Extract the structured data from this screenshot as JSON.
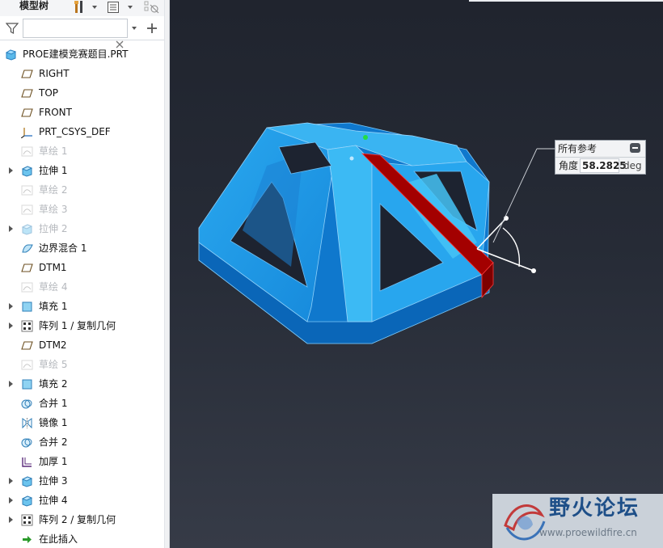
{
  "tree_panel": {
    "title": "模型树",
    "filter": {
      "value": "",
      "placeholder": ""
    },
    "items": [
      {
        "label": "PROE建模竞赛题目.PRT",
        "icon": "part-icon",
        "expand": false,
        "dim": false,
        "root": true
      },
      {
        "label": "RIGHT",
        "icon": "datum-plane-icon",
        "expand": false,
        "dim": false
      },
      {
        "label": "TOP",
        "icon": "datum-plane-icon",
        "expand": false,
        "dim": false
      },
      {
        "label": "FRONT",
        "icon": "datum-plane-icon",
        "expand": false,
        "dim": false
      },
      {
        "label": "PRT_CSYS_DEF",
        "icon": "coordinate-system-icon",
        "expand": false,
        "dim": false
      },
      {
        "label": "草绘 1",
        "icon": "sketch-icon",
        "expand": false,
        "dim": true
      },
      {
        "label": "拉伸 1",
        "icon": "extrude-icon",
        "expand": true,
        "dim": false
      },
      {
        "label": "草绘 2",
        "icon": "sketch-icon",
        "expand": false,
        "dim": true
      },
      {
        "label": "草绘 3",
        "icon": "sketch-icon",
        "expand": false,
        "dim": true
      },
      {
        "label": "拉伸 2",
        "icon": "extrude-icon",
        "expand": true,
        "dim": true
      },
      {
        "label": "边界混合 1",
        "icon": "boundary-blend-icon",
        "expand": false,
        "dim": false
      },
      {
        "label": "DTM1",
        "icon": "datum-plane-icon",
        "expand": false,
        "dim": false
      },
      {
        "label": "草绘 4",
        "icon": "sketch-icon",
        "expand": false,
        "dim": true
      },
      {
        "label": "填充 1",
        "icon": "fill-icon",
        "expand": true,
        "dim": false
      },
      {
        "label": "阵列 1 / 复制几何",
        "icon": "pattern-icon",
        "expand": true,
        "dim": false
      },
      {
        "label": "DTM2",
        "icon": "datum-plane-icon",
        "expand": false,
        "dim": false
      },
      {
        "label": "草绘 5",
        "icon": "sketch-icon",
        "expand": false,
        "dim": true
      },
      {
        "label": "填充 2",
        "icon": "fill-icon",
        "expand": true,
        "dim": false
      },
      {
        "label": "合并 1",
        "icon": "merge-icon",
        "expand": false,
        "dim": false
      },
      {
        "label": "镜像 1",
        "icon": "mirror-icon",
        "expand": false,
        "dim": false
      },
      {
        "label": "合并 2",
        "icon": "merge-icon",
        "expand": false,
        "dim": false
      },
      {
        "label": "加厚 1",
        "icon": "thicken-icon",
        "expand": false,
        "dim": false
      },
      {
        "label": "拉伸 3",
        "icon": "extrude-icon",
        "expand": true,
        "dim": false
      },
      {
        "label": "拉伸 4",
        "icon": "extrude-icon",
        "expand": true,
        "dim": false
      },
      {
        "label": "阵列 2 / 复制几何",
        "icon": "pattern-icon",
        "expand": true,
        "dim": false
      },
      {
        "label": "在此插入",
        "icon": "insert-here-arrow-icon",
        "expand": false,
        "dim": false
      }
    ]
  },
  "reference_dialog": {
    "title": "所有参考",
    "angle_label": "角度",
    "angle_value": "58.2825",
    "angle_unit": "deg"
  },
  "watermark": {
    "title": "野火论坛",
    "url": "www.proewildfire.cn"
  },
  "colors": {
    "model_face": "#1e9ce8",
    "model_light": "#33b6f3",
    "model_dark": "#0d72c8",
    "highlight_edge": "#a00000",
    "viewport_bg": "#242833"
  }
}
